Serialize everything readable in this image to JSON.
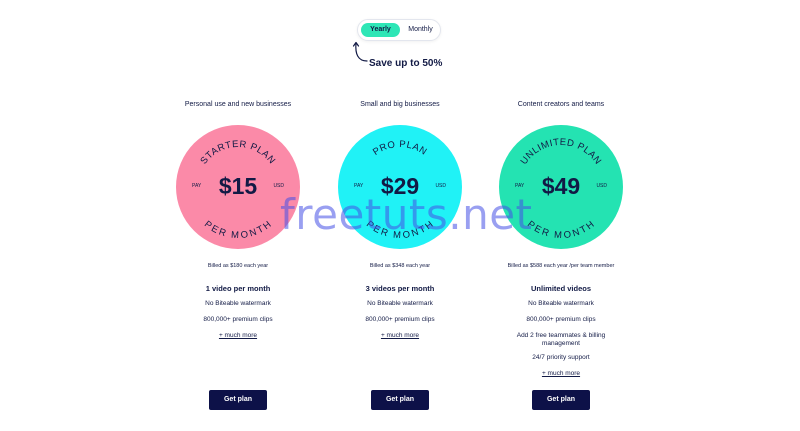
{
  "billing_toggle": {
    "yearly_label": "Yearly",
    "monthly_label": "Monthly",
    "selected": "Yearly",
    "accent": "#2ee6b6"
  },
  "save_text": "Save up to 50%",
  "plans": [
    {
      "subtitle": "Personal use and new businesses",
      "name": "STARTER PLAN",
      "price": "$15",
      "pay": "PAY",
      "currency": "USD",
      "period": "PER MONTH",
      "color": "#fb8aa8",
      "billed": "Billed as $180 each year",
      "features": [
        "1 video per month",
        "No Biteable watermark",
        "800,000+ premium clips"
      ],
      "more": "+ much more",
      "cta": "Get plan"
    },
    {
      "subtitle": "Small and big businesses",
      "name": "PRO PLAN",
      "price": "$29",
      "pay": "PAY",
      "currency": "USD",
      "period": "PER MONTH",
      "color": "#20f2f6",
      "billed": "Billed as $348 each year",
      "features": [
        "3 videos per month",
        "No Biteable watermark",
        "800,000+ premium clips"
      ],
      "more": "+ much more",
      "cta": "Get plan"
    },
    {
      "subtitle": "Content creators and teams",
      "name": "UNLIMITED PLAN",
      "price": "$49",
      "pay": "PAY",
      "currency": "USD",
      "period": "PER MONTH",
      "color": "#24e3b2",
      "billed": "Billed as $588 each year /per team member",
      "features": [
        "Unlimited videos",
        "No Biteable watermark",
        "800,000+ premium clips",
        "Add 2 free teammates & billing management",
        "24/7 priority support"
      ],
      "more": "+ much more",
      "cta": "Get plan"
    }
  ],
  "watermark": "freetuts.net"
}
